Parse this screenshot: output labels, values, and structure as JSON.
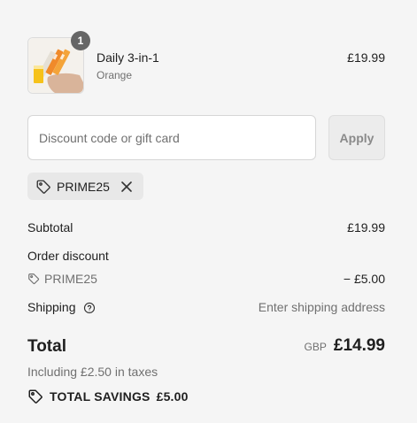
{
  "line_item": {
    "quantity": "1",
    "name": "Daily 3-in-1",
    "variant": "Orange",
    "price": "£19.99",
    "thumbnail_icon": "product-thumbnail"
  },
  "discount": {
    "placeholder": "Discount code or gift card",
    "value": "",
    "apply_label": "Apply",
    "applied_code": "PRIME25",
    "tag_icon": "tag-icon",
    "remove_icon": "close-icon"
  },
  "summary": {
    "subtotal_label": "Subtotal",
    "subtotal_value": "£19.99",
    "order_discount_label": "Order discount",
    "discount_code": "PRIME25",
    "discount_value": "− £5.00",
    "shipping_label": "Shipping",
    "shipping_value": "Enter shipping address",
    "help_icon": "question-circle-icon"
  },
  "total": {
    "label": "Total",
    "currency": "GBP",
    "amount": "£14.99",
    "tax_note": "Including £2.50 in taxes",
    "savings_label": "TOTAL SAVINGS",
    "savings_value": "£5.00",
    "savings_icon": "tag-icon"
  },
  "colors": {
    "background": "#f5f5f5",
    "text": "#1f1f1f",
    "muted": "#707070",
    "badge": "#666666"
  }
}
